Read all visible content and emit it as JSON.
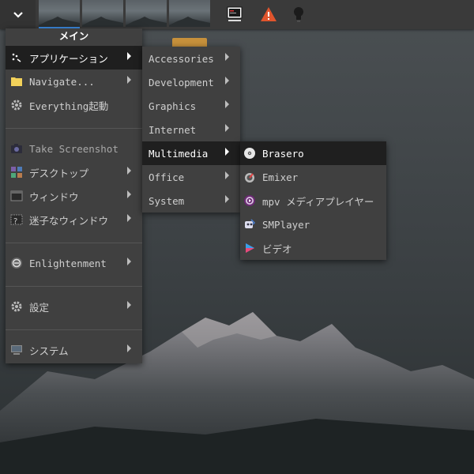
{
  "shelf": {
    "menu_button_icon": "chevron-down-icon",
    "desktops": [
      "desktop-1",
      "desktop-2",
      "desktop-3",
      "desktop-4"
    ],
    "tray_icons": [
      "terminal-monitor-icon",
      "warning-icon",
      "lightbulb-icon"
    ],
    "accent_color": "#3d8ee6"
  },
  "main_menu": {
    "title": "メイン",
    "items": [
      {
        "label": "アプリケーション",
        "icon": "applications-icon",
        "submenu": true,
        "selected": true
      },
      {
        "label": "Navigate...",
        "icon": "folder-icon",
        "submenu": true
      },
      {
        "label": "Everything起動",
        "icon": "gear-icon",
        "submenu": false
      },
      {
        "label": "Take Screenshot",
        "icon": "camera-icon",
        "submenu": false
      },
      {
        "label": "デスクトップ",
        "icon": "desktop-grid-icon",
        "submenu": true
      },
      {
        "label": "ウィンドウ",
        "icon": "window-icon",
        "submenu": true
      },
      {
        "label": "迷子なウィンドウ",
        "icon": "lost-window-icon",
        "submenu": true
      },
      {
        "label": "Enlightenment",
        "icon": "enlightenment-logo-icon",
        "submenu": true
      },
      {
        "label": "設定",
        "icon": "settings-gear-icon",
        "submenu": true
      },
      {
        "label": "システム",
        "icon": "computer-icon",
        "submenu": true
      }
    ]
  },
  "apps_menu": {
    "items": [
      {
        "label": "Accessories"
      },
      {
        "label": "Development"
      },
      {
        "label": "Graphics"
      },
      {
        "label": "Internet"
      },
      {
        "label": "Multimedia",
        "selected": true
      },
      {
        "label": "Office"
      },
      {
        "label": "System"
      }
    ]
  },
  "multimedia_menu": {
    "items": [
      {
        "label": "Brasero",
        "icon": "disc-icon",
        "selected": true
      },
      {
        "label": "Emixer",
        "icon": "mixer-icon"
      },
      {
        "label": "mpv メディアプレイヤー",
        "icon": "mpv-icon"
      },
      {
        "label": "SMPlayer",
        "icon": "smplayer-icon"
      },
      {
        "label": "ビデオ",
        "icon": "video-play-icon"
      }
    ]
  }
}
